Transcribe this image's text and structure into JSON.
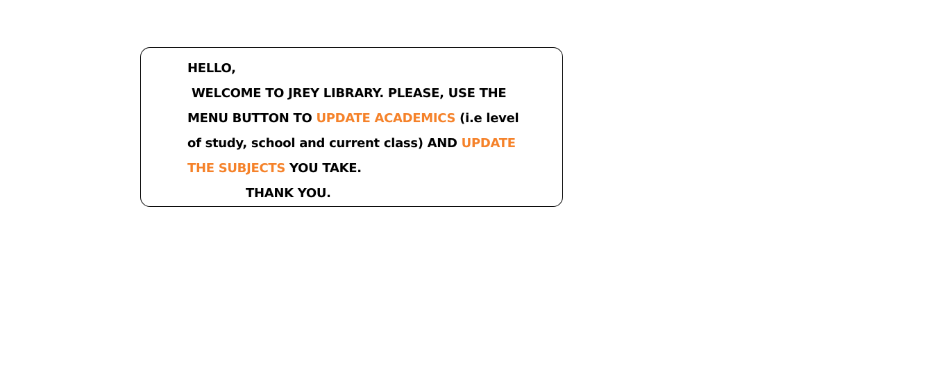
{
  "colors": {
    "text": "#000000",
    "highlight": "#f5822a",
    "border": "#000000",
    "background": "#ffffff"
  },
  "message": {
    "greeting": "HELLO,",
    "line1": "WELCOME TO JREY LIBRARY. PLEASE, USE THE",
    "line2_a": "MENU BUTTON TO ",
    "line2_b": "UPDATE ACADEMICS",
    "line2_c": " (i.e level",
    "line3_a": "of study, school and current class) AND ",
    "line3_b": "UPDATE",
    "line4_a": "THE SUBJECTS",
    "line4_b": " YOU TAKE.",
    "thanks": "THANK YOU."
  }
}
